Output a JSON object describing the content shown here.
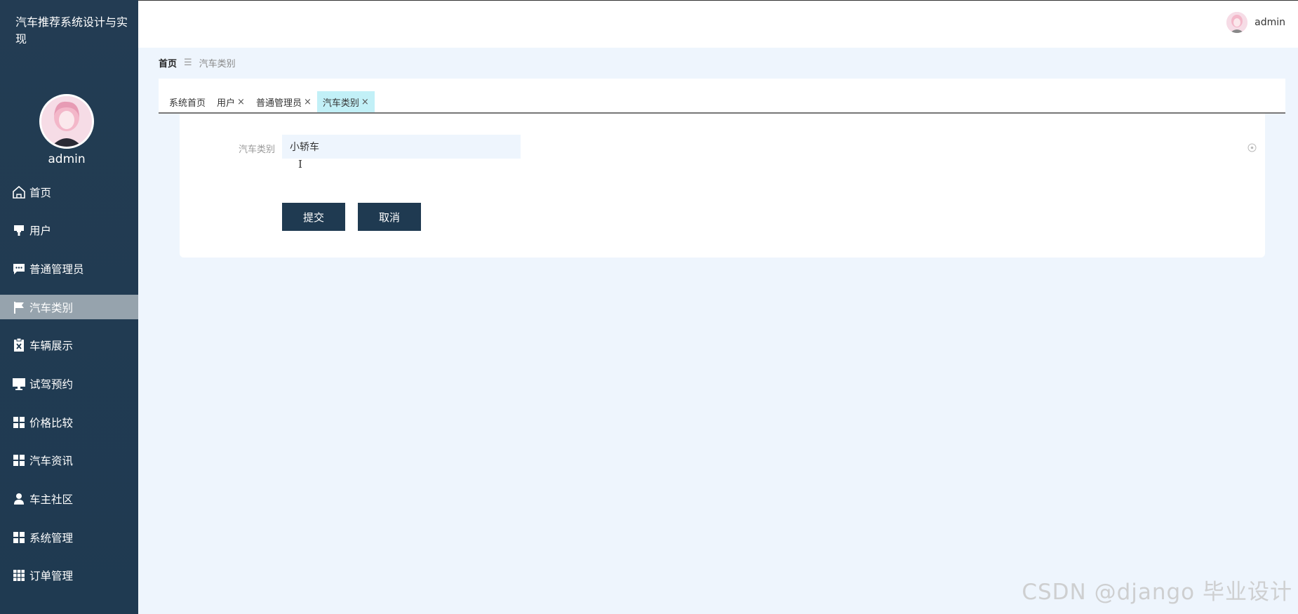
{
  "app": {
    "title": "汽车推荐系统设计与实现",
    "username": "admin"
  },
  "sidebar": {
    "items": [
      {
        "label": "首页",
        "icon": "home-icon"
      },
      {
        "label": "用户",
        "icon": "brush-icon"
      },
      {
        "label": "普通管理员",
        "icon": "chat-icon"
      },
      {
        "label": "汽车类别",
        "icon": "flag-icon",
        "active": true
      },
      {
        "label": "车辆展示",
        "icon": "clipboard-x-icon"
      },
      {
        "label": "试驾预约",
        "icon": "monitor-icon"
      },
      {
        "label": "价格比较",
        "icon": "grid-icon"
      },
      {
        "label": "汽车资讯",
        "icon": "grid-icon"
      },
      {
        "label": "车主社区",
        "icon": "user-icon"
      },
      {
        "label": "系统管理",
        "icon": "grid-icon"
      },
      {
        "label": "订单管理",
        "icon": "grid-3x3-icon"
      }
    ]
  },
  "header": {
    "username": "admin"
  },
  "breadcrumb": {
    "home": "首页",
    "separator": "☰",
    "current": "汽车类别"
  },
  "tabs": [
    {
      "label": "系统首页",
      "closable": false
    },
    {
      "label": "用户",
      "closable": true
    },
    {
      "label": "普通管理员",
      "closable": true
    },
    {
      "label": "汽车类别",
      "closable": true,
      "active": true
    }
  ],
  "tab_close_glyph": "×",
  "form": {
    "label": "汽车类别",
    "value": "小轿车",
    "submit_label": "提交",
    "cancel_label": "取消"
  },
  "watermark": "CSDN @django 毕业设计",
  "colors": {
    "sidebar_bg": "#1f3a51",
    "active_item": "#96a3ad",
    "active_tab": "#c2f0f7",
    "button_bg": "#1f3a51",
    "page_bg": "#eef5fd"
  }
}
